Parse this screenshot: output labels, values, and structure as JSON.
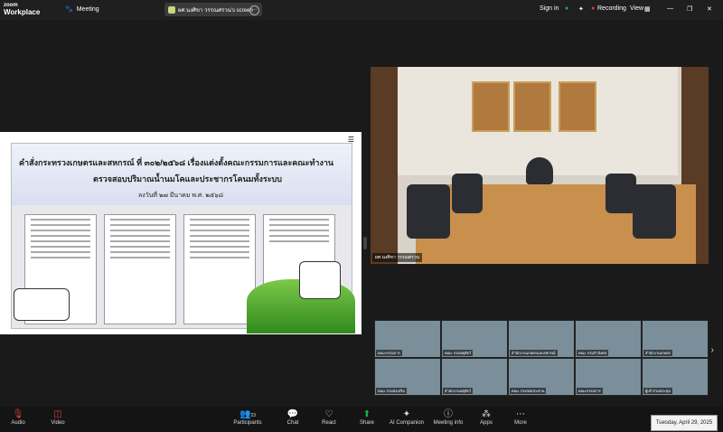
{
  "app": {
    "brand_top": "zoom",
    "brand_bottom": "Workplace",
    "meeting_label": "Meeting"
  },
  "share": {
    "label": "ผศ.นงศิขา วรรณศรวน's screen"
  },
  "topright": {
    "signin": "Sign in",
    "recording": "Recording",
    "view": "View"
  },
  "slide": {
    "line1": "คำสั่งกระทรวงเกษตรและสหกรณ์ ที่ ๓๐๒/๒๕๖๘ เรื่องแต่งตั้งคณะกรรมการและคณะทำงาน",
    "line2": "ตรวจสอบปริมาณน้ำนมโคและประชากรโคนมทั้งระบบ",
    "line3": "ลงวันที่ ๒๗ มีนาคม พ.ศ. ๒๕๖๘"
  },
  "video": {
    "name": "ผศ.นงศิขา วรรณศรวน"
  },
  "tiles": [
    "คณะกรรมการ",
    "คณะ กรมปศุสัตว์",
    "สำนักงานเกษตรและสหกรณ์",
    "คณะ กรมกำลังทส",
    "สำนักงานเกษตร",
    "คณะ กรมส่งเสริม",
    "สำนักงานปศุสัตว์",
    "คณะ กรมชลประทาน",
    "คณะกรรมการ",
    "ผู้เข้าร่วมประชุม"
  ],
  "toolbar": {
    "audio": "Audio",
    "video": "Video",
    "participants": "Participants",
    "participants_count": "23",
    "chat": "Chat",
    "react": "React",
    "share": "Share",
    "ai": "AI Companion",
    "info": "Meeting info",
    "apps": "Apps",
    "more": "More"
  },
  "date": "Tuesday, April 29, 2025",
  "colors": {
    "share_green": "#19b33e",
    "record_red": "#e53935",
    "audio_off": "#e53935"
  }
}
